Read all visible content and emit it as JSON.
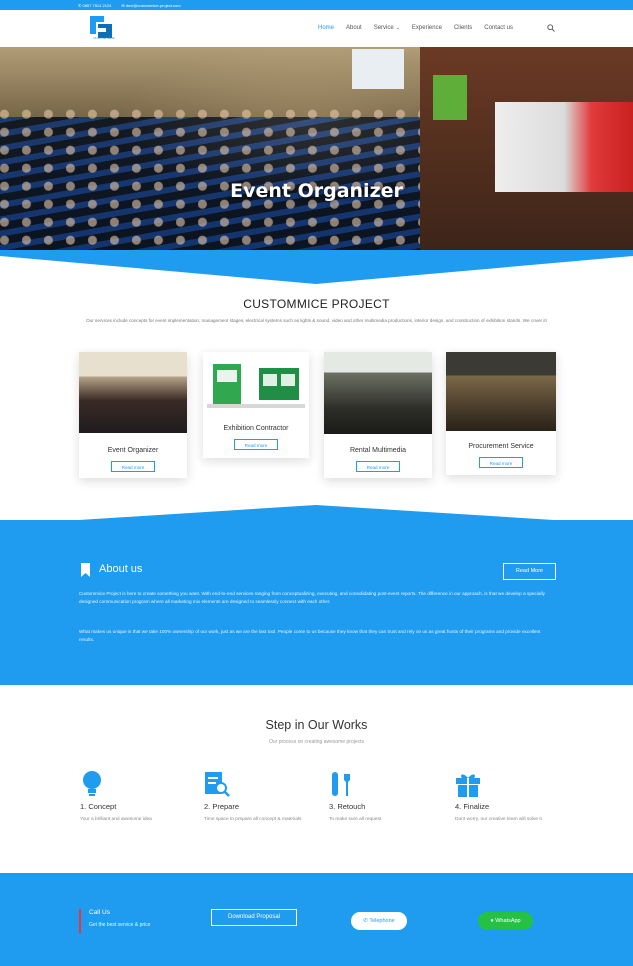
{
  "topbar": {
    "phone": "0857 7514 2124",
    "email": "devi@custommice-project.com"
  },
  "brand": {
    "logo_text": "CUSTOM MICE"
  },
  "nav": {
    "items": [
      "Home",
      "About",
      "Service",
      "Experience",
      "Clients",
      "Contact us"
    ],
    "active": "Home"
  },
  "hero": {
    "title": "Event Organizer",
    "slides": 4
  },
  "intro": {
    "title": "CUSTOMMICE PROJECT",
    "desc": "Our services include concepts for event implementation, management stages, electrical systems such as lights & sound, video and other multimedia productions, interior design, and construction of exhibition stands. We cover it!"
  },
  "services": [
    {
      "title": "Event Organizer",
      "button": "Read more"
    },
    {
      "title": "Exhibition Contractor",
      "button": "Read more"
    },
    {
      "title": "Rental Multimedia",
      "button": "Read more"
    },
    {
      "title": "Procurement Service",
      "button": "Read more"
    }
  ],
  "about": {
    "title": "About us",
    "button": "Read More",
    "p1": "Custommice Project is here to create something you want. With end-to-end services ranging from conceptualizing, executing, and consolidating post-event reports. The difference in our approach, is that we develop a specially designed communication program where all marketing mix elements are designed to seamlessly connect with each other.",
    "p2": "What makes us unique is that we take 100% ownership of our work, just as we are the last tool. People come to us because they know that they can trust and rely on us as great hosts of their programs and provide excellent results."
  },
  "steps": {
    "title": "Step in Our Works",
    "subtitle": "Our process on creating awesome projects",
    "items": [
      {
        "title": "1. Concept",
        "desc": "Your a brilliant and awesome idea"
      },
      {
        "title": "2. Prepare",
        "desc": "Time space to prepare all concept & materials"
      },
      {
        "title": "3. Retouch",
        "desc": "To make sure all request"
      },
      {
        "title": "4. Finalize",
        "desc": "Dont worry, our creative team will solve it"
      }
    ]
  },
  "footer": {
    "call_title": "Call Us",
    "call_sub": "Get the best service & price",
    "download": "Download Proposal",
    "telephone": "Telephone",
    "whatsapp": "WhatsApp"
  },
  "colors": {
    "accent": "#1f9cf0",
    "whatsapp": "#25c144",
    "call_bar": "#ee3333"
  }
}
